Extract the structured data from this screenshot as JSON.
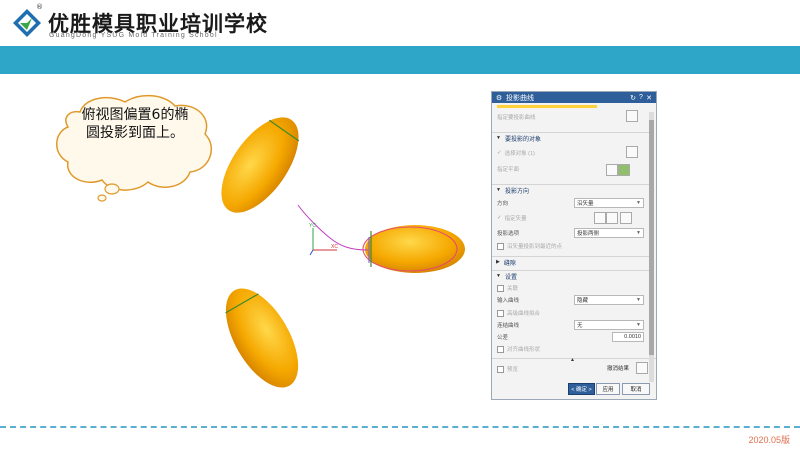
{
  "header": {
    "title": "优胜模具职业培训学校",
    "subtitle": "GuangDong YSUG Mold Training School",
    "registered_mark": "®"
  },
  "callout": {
    "text": "俯视图偏置6的椭圆投影到面上。"
  },
  "viewport": {
    "axis_x_label": "XC",
    "axis_y_label": "YC"
  },
  "dialog": {
    "title": "投影曲线",
    "top_label": "指定要投影曲线",
    "sections": {
      "target": "要投影的对象",
      "direction": "投影方向",
      "gap": "缝隙",
      "settings": "设置"
    },
    "target": {
      "select_object": "选择对象 (1)",
      "specify_plane": "指定平面"
    },
    "direction": {
      "direction_label": "方向",
      "direction_value": "沿矢量",
      "specify_vector": "指定矢量",
      "project_option_label": "投影选项",
      "project_option_value": "投影两侧",
      "nearest_point": "沿矢量投影到最近的点"
    },
    "settings": {
      "associative": "关联",
      "input_curves_label": "输入曲线",
      "input_curves_value": "隐藏",
      "high_level_curve_fit": "高级曲线拟合",
      "join_curves_label": "连结曲线",
      "join_curves_value": "无",
      "tolerance_label": "公差",
      "tolerance_value": "0.0010",
      "align_curve_shape": "对齐曲线形状"
    },
    "preview": "预览",
    "undo_result": "撤消结果",
    "buttons": {
      "ok": "< 确定 >",
      "apply": "应用",
      "cancel": "取消"
    }
  },
  "footer": {
    "version": "2020.05版"
  },
  "colors": {
    "band": "#2ea6c8",
    "dialog_title": "#2f5f9a",
    "body_yellow": "#f5a800",
    "version_text": "#e07050"
  }
}
